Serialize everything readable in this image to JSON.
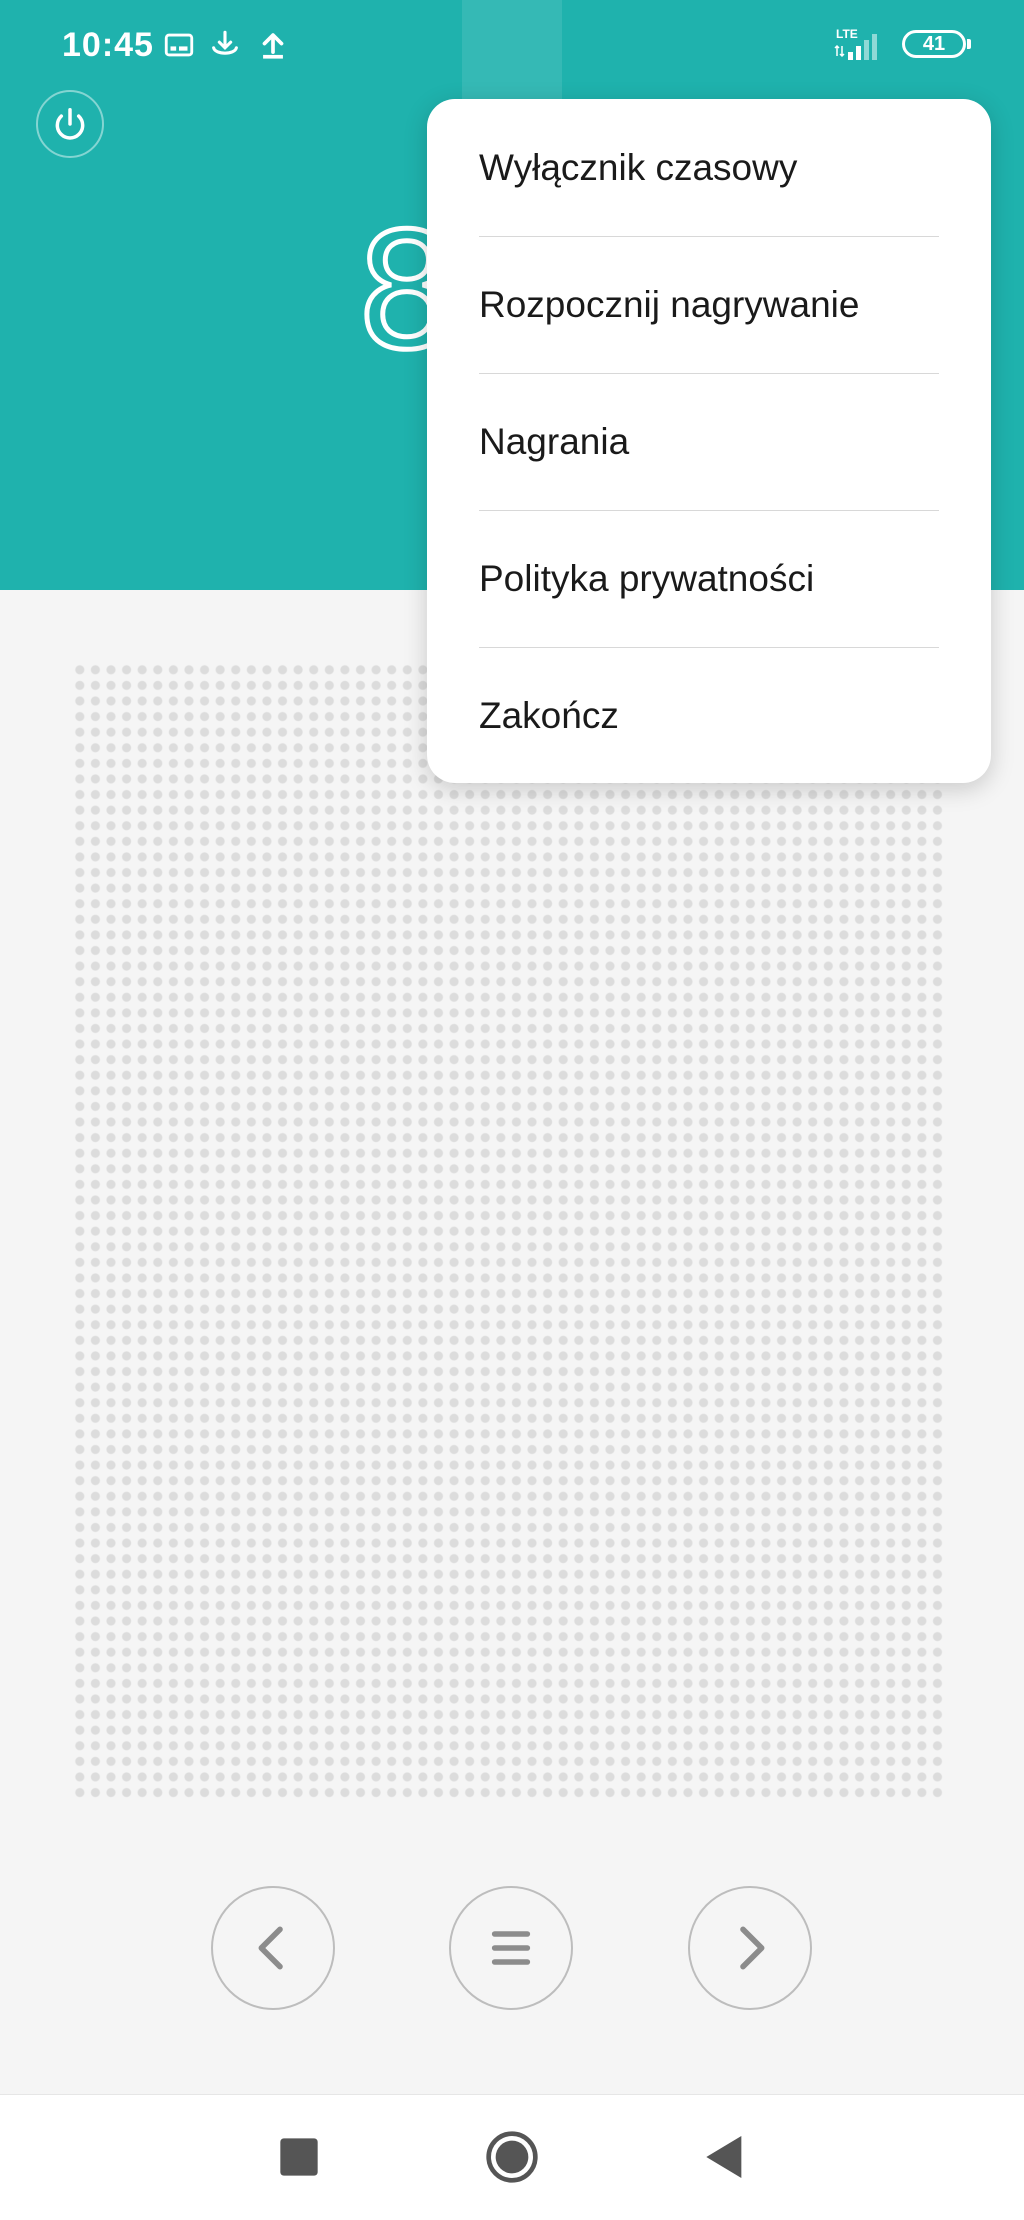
{
  "status_bar": {
    "time": "10:45",
    "network": "LTE",
    "battery": "41"
  },
  "main": {
    "display_value": "8"
  },
  "menu": {
    "items": [
      {
        "label": "Wyłącznik czasowy"
      },
      {
        "label": "Rozpocznij nagrywanie"
      },
      {
        "label": "Nagrania"
      },
      {
        "label": "Polityka prywatności"
      },
      {
        "label": "Zakończ"
      }
    ]
  },
  "colors": {
    "header_bg": "#1fb2ad",
    "page_bg": "#f5f5f5",
    "menu_bg": "#ffffff"
  },
  "icons": {
    "status": [
      "gallery-icon",
      "download-icon",
      "upload-icon"
    ],
    "power": "power-icon",
    "controls": [
      "chevron-left-icon",
      "menu-lines-icon",
      "chevron-right-icon"
    ],
    "nav": [
      "recents-square-icon",
      "home-circle-icon",
      "back-triangle-icon"
    ]
  }
}
